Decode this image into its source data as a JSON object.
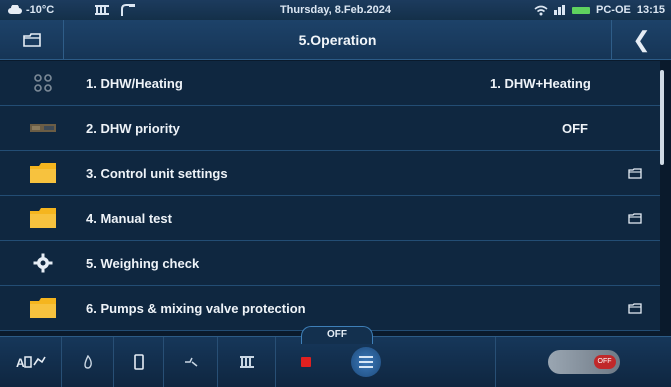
{
  "status_bar": {
    "temperature": "-10°C",
    "date": "Thursday, 8.Feb.2024",
    "network_name": "PC-OE",
    "time": "13:15"
  },
  "header": {
    "title": "5.Operation"
  },
  "rows": [
    {
      "label": "1.  DHW/Heating",
      "value": "1. DHW+Heating",
      "icon": "dots-grid-icon"
    },
    {
      "label": "2.  DHW priority",
      "value": "OFF",
      "icon": "tank-icon"
    },
    {
      "label": "3.  Control unit settings",
      "icon": "folder-icon",
      "has_folder_button": true
    },
    {
      "label": "4.  Manual test",
      "icon": "folder-icon",
      "has_folder_button": true
    },
    {
      "label": "5.  Weighing check",
      "icon": "gear-icon"
    },
    {
      "label": "6.  Pumps & mixing valve protection",
      "icon": "folder-icon",
      "has_folder_button": true
    }
  ],
  "bottom_bar": {
    "off_label": "OFF",
    "toggle_label": "OFF"
  },
  "colors": {
    "folder": "#f5b51e",
    "stop": "#e02020"
  }
}
